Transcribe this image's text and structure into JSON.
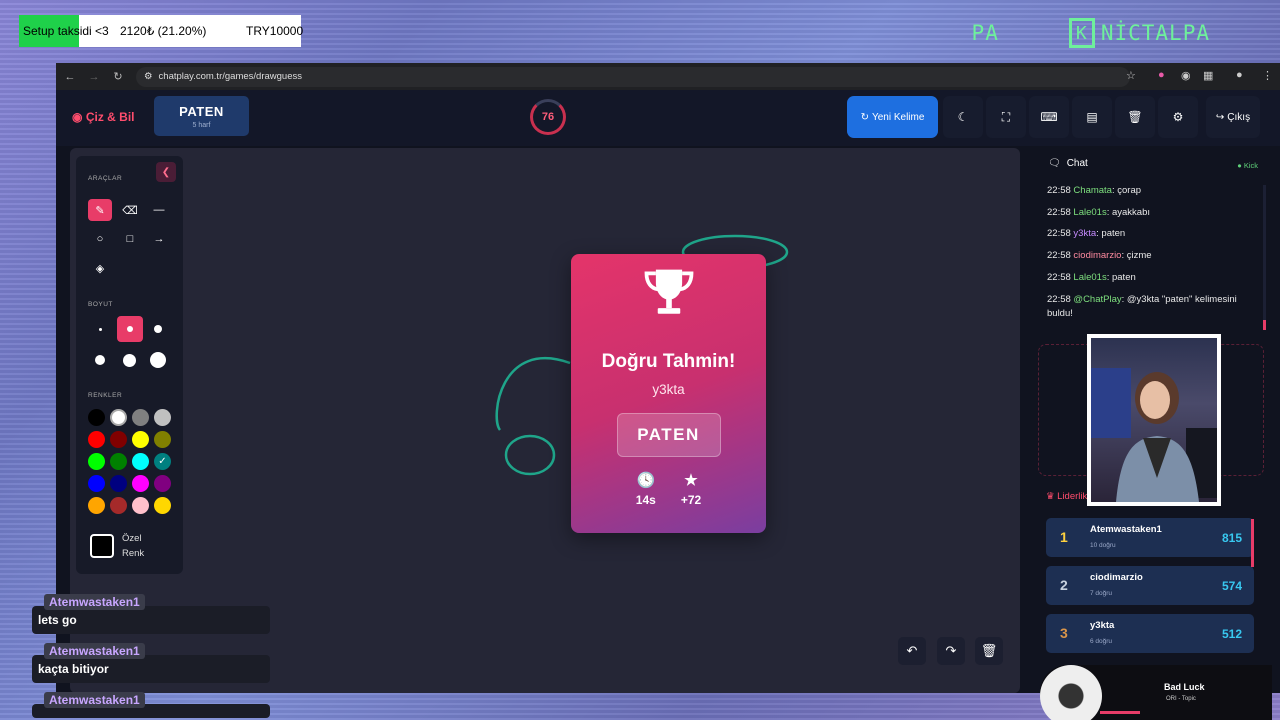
{
  "overlay": {
    "goal_label": "Setup taksidi <3",
    "goal_amount": "2120₺ (21.20%)",
    "goal_target": "TRY10000",
    "goal_fraction": 0.212,
    "brand_left": "PA",
    "brand_right": "NİCTALPA"
  },
  "browser": {
    "url": "chatplay.com.tr/games/drawguess"
  },
  "header": {
    "logo": "Çiz & Bil",
    "word": "PATEN",
    "word_len": "5 harf",
    "timer": "76",
    "new_word": "Yeni Kelime",
    "exit": "Çıkış"
  },
  "tools": {
    "section_tools": "ARAÇLAR",
    "section_size": "BOYUT",
    "section_colors": "RENKLER",
    "custom_color": "Özel Renk",
    "colors": [
      "#000000",
      "#ffffff",
      "#808080",
      "#c0c0c0",
      "#ff0000",
      "#800000",
      "#ffff00",
      "#808000",
      "#00ff00",
      "#008000",
      "#00ffff",
      "#008080",
      "#0000ff",
      "#000080",
      "#ff00ff",
      "#800080",
      "#ffa500",
      "#a52a2a",
      "#ffc0cb",
      "#ffd700"
    ]
  },
  "result": {
    "title": "Doğru Tahmin!",
    "winner": "y3kta",
    "word": "PATEN",
    "time": "14s",
    "points": "+72"
  },
  "chat": {
    "title": "Chat",
    "source": "Kick",
    "messages": [
      {
        "time": "22:58",
        "user": "Chamata",
        "text": ": çorap",
        "color": "#7ee07e"
      },
      {
        "time": "22:58",
        "user": "Lale01s",
        "text": ": ayakkabı",
        "color": "#7ee07e"
      },
      {
        "time": "22:58",
        "user": "y3kta",
        "text": ": paten",
        "color": "#c78cff"
      },
      {
        "time": "22:58",
        "user": "ciodimarzio",
        "text": ": çizme",
        "color": "#ff8ba0"
      },
      {
        "time": "22:58",
        "user": "Lale01s",
        "text": ": paten",
        "color": "#7ee07e"
      },
      {
        "time": "22:58",
        "user": "@ChatPlay",
        "text": ": @y3kta \"paten\" kelimesini buldu!",
        "color": "#7ee07e"
      }
    ]
  },
  "leaderboard": {
    "title": "Liderlik Tablosu",
    "rows": [
      {
        "rank": "1",
        "name": "Atemwastaken1",
        "detail": "10 doğru",
        "points": "815",
        "rank_color": "#ffd23f"
      },
      {
        "rank": "2",
        "name": "ciodimarzio",
        "detail": "7 doğru",
        "points": "574",
        "rank_color": "#c8d2e0"
      },
      {
        "rank": "3",
        "name": "y3kta",
        "detail": "6 doğru",
        "points": "512",
        "rank_color": "#d9954a"
      }
    ]
  },
  "stream_chat": [
    {
      "user": "Atemwastaken1",
      "text": "lets go"
    },
    {
      "user": "Atemwastaken1",
      "text": "kaçta bitiyor"
    },
    {
      "user": "Atemwastaken1",
      "text": ""
    }
  ],
  "music": {
    "title": "Bad Luck",
    "artist": "ORI - Topic"
  }
}
